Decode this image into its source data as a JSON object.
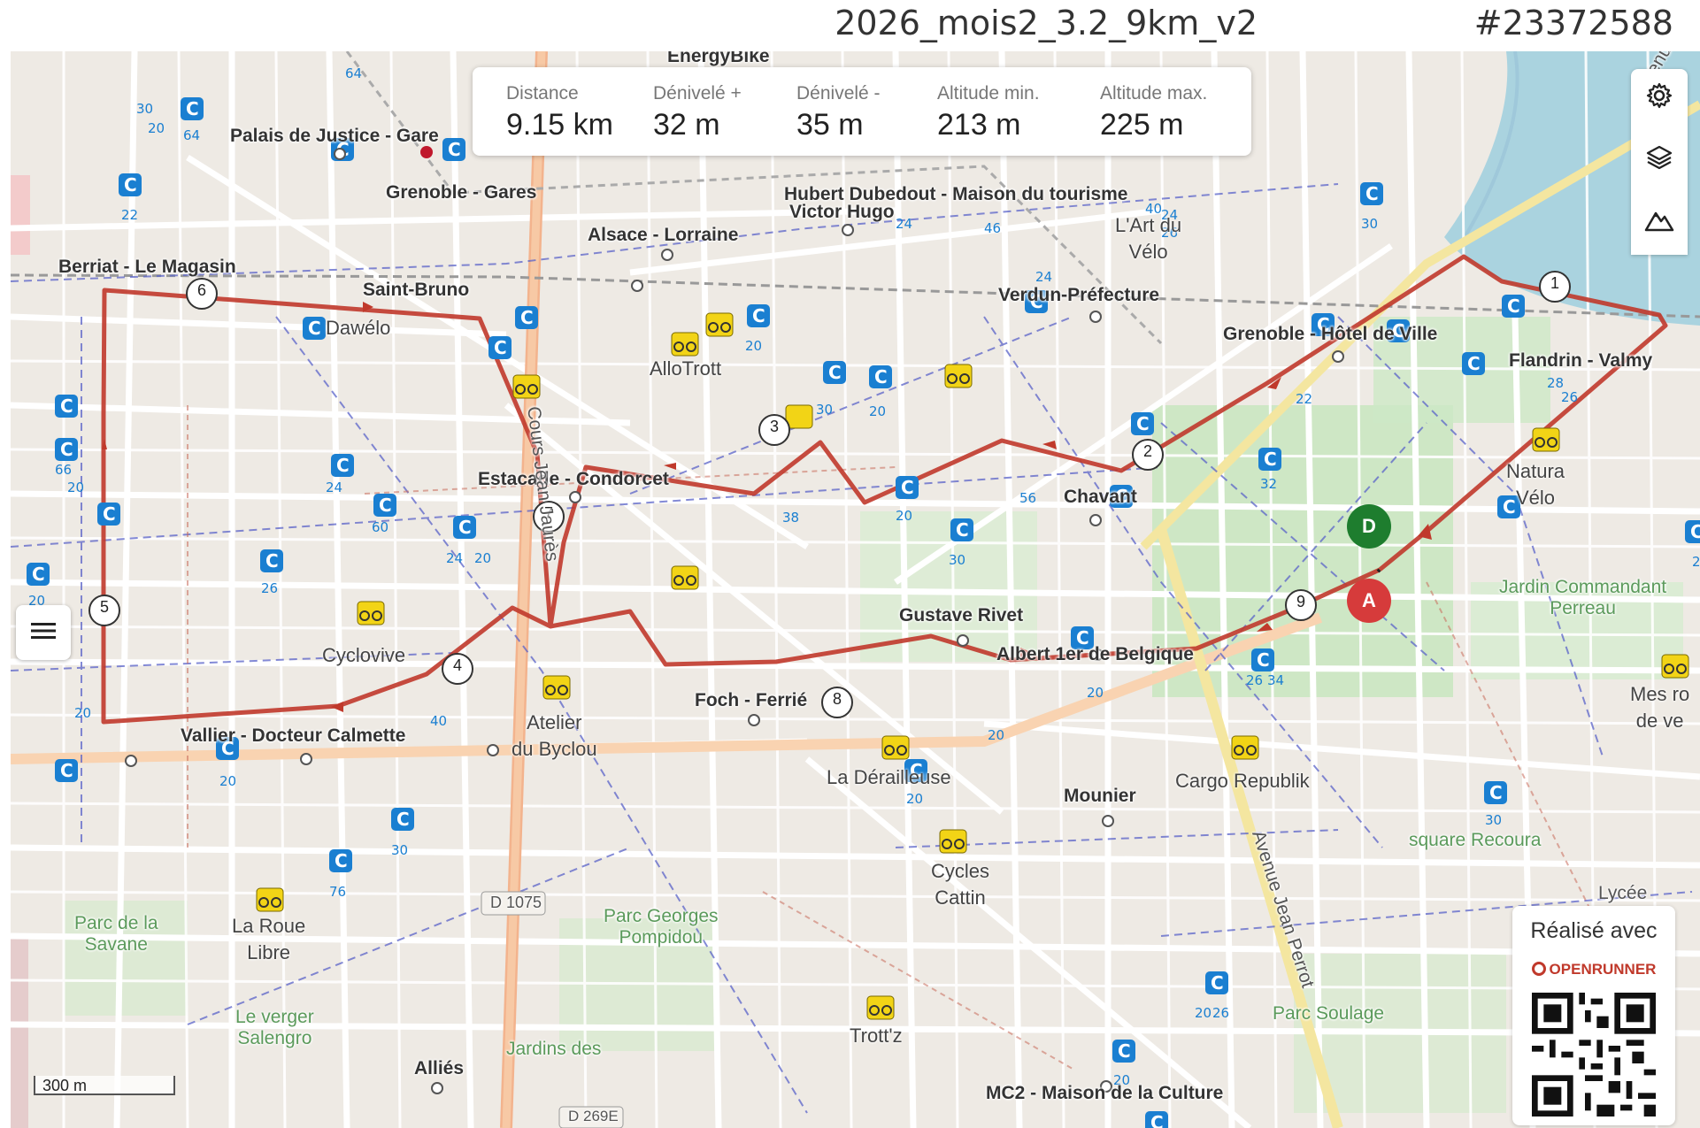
{
  "header": {
    "route_name": "2026_mois2_3.2_9km_v2",
    "route_id": "#23372588"
  },
  "stats": [
    {
      "label": "Distance",
      "value": "9.15 km"
    },
    {
      "label": "Dénivelé +",
      "value": "32 m"
    },
    {
      "label": "Dénivelé -",
      "value": "35 m"
    },
    {
      "label": "Altitude min.",
      "value": "213 m"
    },
    {
      "label": "Altitude max.",
      "value": "225 m"
    }
  ],
  "controls": {
    "settings_icon": "gear-icon",
    "layers_icon": "layers-icon",
    "elevation_icon": "mountain-icon",
    "menu_icon": "hamburger-icon"
  },
  "map": {
    "places": {
      "p1": "Palais de Justice - Gare",
      "p2": "Grenoble - Gares",
      "p3": "Alsace - Lorraine",
      "p4": "Hubert Dubedout - Maison du tourisme",
      "p5": "Victor Hugo",
      "p6": "Berriat - Le Magasin",
      "p7": "Saint-Bruno",
      "p8": "Verdun-Préfecture",
      "p9": "Grenoble - Hôtel de Ville",
      "p10": "Flandrin - Valmy",
      "p11": "Estacade - Condorcet",
      "p12": "Chavant",
      "p13": "Gustave Rivet",
      "p14": "Albert 1er de Belgique",
      "p15": "Foch - Ferrié",
      "p16": "Vallier - Docteur Calmette",
      "p17": "Mounier",
      "p18": "Alliés",
      "p19": "MC2 - Maison de la Culture",
      "p20": "EnergyBike"
    },
    "pois": {
      "q1": "AlloTrott",
      "q2": "Dawélo",
      "q3": "Cyclovive",
      "q4": "Atelier\ndu Byclou",
      "q5": "La Dérailleuse",
      "q6": "Cargo Republik",
      "q7": "Cycles\nCattin",
      "q8": "La Roue\nLibre",
      "q9": "Trott'z",
      "q10": "Natura\nVélo",
      "q11": "L'Art du\nVélo",
      "q12": "Mes ro\nde ve"
    },
    "green_labels": {
      "g1": "Jardin Commandant\nPerreau",
      "g2": "square Recoura",
      "g3": "Parc Soulage",
      "g4": "Parc Georges\nPompidou",
      "g5": "Parc de la\nSavane",
      "g6": "Le verger\nSalengro",
      "g7": "Jardins des"
    },
    "streets": {
      "s1": "Cours Jean Jaurès",
      "s2": "Avenue Jean Perrot",
      "s3": "Avenue"
    },
    "roads": {
      "r1": "D 1075",
      "r2": "D 269E"
    },
    "misc": {
      "lycee": "Lycée",
      "bus_numbers": [
        "30",
        "20",
        "64",
        "22",
        "24",
        "40",
        "20",
        "66",
        "20",
        "26",
        "60",
        "24",
        "20",
        "38",
        "44",
        "46",
        "40",
        "26",
        "30",
        "20",
        "28",
        "22",
        "32",
        "56",
        "30",
        "24",
        "28",
        "22",
        "20",
        "26",
        "34",
        "20",
        "30",
        "76",
        "20",
        "26",
        "20",
        "40"
      ]
    },
    "waypoints": [
      "1",
      "2",
      "3",
      "4",
      "5",
      "6",
      "7",
      "8",
      "9"
    ],
    "start_label": "D",
    "end_label": "A",
    "route_color": "#c0392b"
  },
  "scale": {
    "label": "300 m"
  },
  "credit": {
    "text": "Réalisé avec",
    "brand": "OPENRUNNER"
  }
}
